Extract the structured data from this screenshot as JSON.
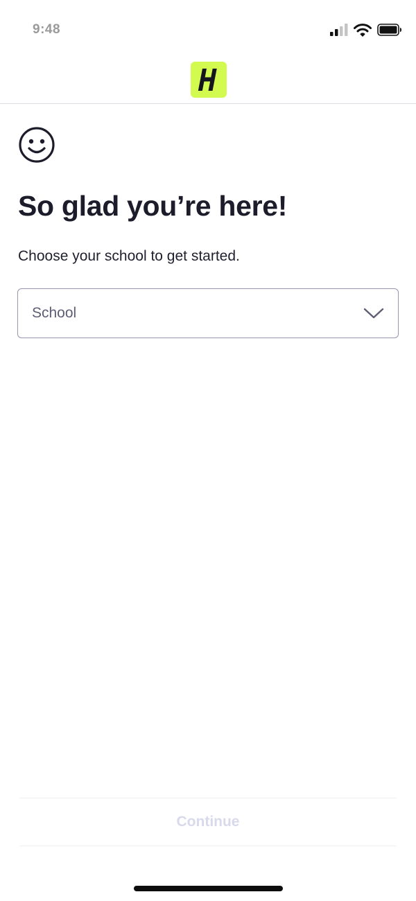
{
  "status_bar": {
    "time": "9:48",
    "icons": [
      "cellular-signal-icon",
      "wifi-icon",
      "battery-icon"
    ]
  },
  "header": {
    "logo_letter": "H",
    "logo_color": "#d3fa4f"
  },
  "main": {
    "icon": "smiley-face-icon",
    "title": "So glad you’re here!",
    "subtitle": "Choose your school to get started."
  },
  "school_select": {
    "placeholder": "School",
    "icon": "chevron-down-icon"
  },
  "footer": {
    "continue_label": "Continue",
    "continue_disabled": true
  },
  "colors": {
    "text_primary": "#1c1c2b",
    "select_border": "#9595ab",
    "disabled_text": "#d9d9ee"
  }
}
